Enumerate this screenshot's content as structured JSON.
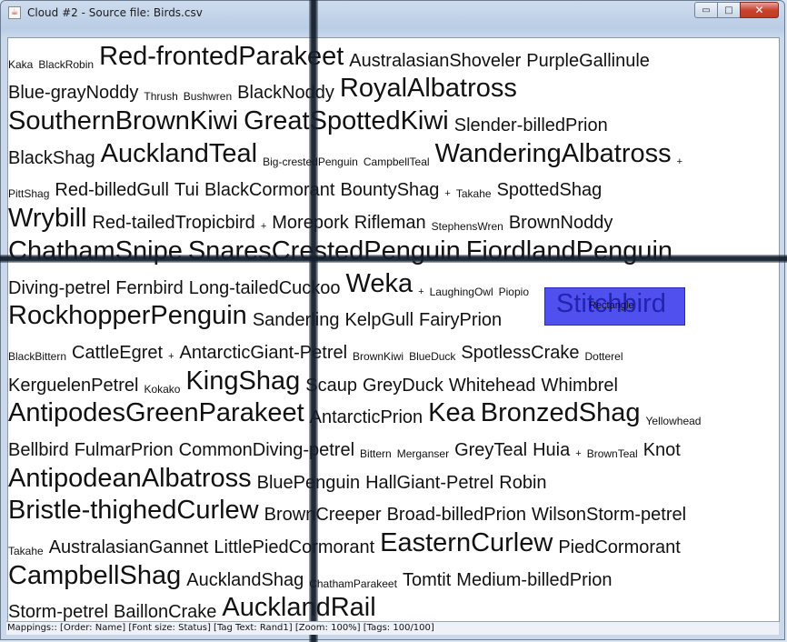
{
  "window": {
    "title": "Cloud #2 - Source file: Birds.csv",
    "controls": {
      "minimize": "▭",
      "maximize": "□",
      "close": "✕"
    },
    "app_icon": "java-cup-icon"
  },
  "cloud": {
    "rows": [
      [
        [
          "Kaka",
          1
        ],
        [
          "BlackRobin",
          1
        ],
        [
          "Red-frontedParakeet",
          3
        ],
        [
          "AustralasianShoveler",
          2
        ],
        [
          "PurpleGallinule",
          2
        ]
      ],
      [
        [
          "Blue-grayNoddy",
          2
        ],
        [
          "Thrush",
          1
        ],
        [
          "Bushwren",
          1
        ],
        [
          "BlackNoddy",
          2
        ],
        [
          "RoyalAlbatross",
          3
        ]
      ],
      [
        [
          "SouthernBrownKiwi",
          3
        ],
        [
          "GreatSpottedKiwi",
          3
        ],
        [
          "Slender-billedPrion",
          2
        ]
      ],
      [
        [
          "BlackShag",
          2
        ],
        [
          "AucklandTeal",
          3
        ],
        [
          "Big-crestedPenguin",
          1
        ],
        [
          "CampbellTeal",
          1
        ],
        [
          "WanderingAlbatross",
          3
        ],
        [
          "+",
          0
        ]
      ],
      [
        [
          "PittShag",
          1
        ],
        [
          "Red-billedGull",
          2
        ],
        [
          "Tui",
          2
        ],
        [
          "BlackCormorant",
          2
        ],
        [
          "BountyShag",
          2
        ],
        [
          "+",
          0
        ],
        [
          "Takahe",
          1
        ],
        [
          "SpottedShag",
          2
        ]
      ],
      [
        [
          "Wrybill",
          3
        ],
        [
          "Red-tailedTropicbird",
          2
        ],
        [
          "+",
          0
        ],
        [
          "Morepork",
          2
        ],
        [
          "Rifleman",
          2
        ],
        [
          "StephensWren",
          1
        ],
        [
          "BrownNoddy",
          2
        ]
      ],
      [
        [
          "ChathamSnipe",
          3
        ],
        [
          "SnaresCrestedPenguin",
          3
        ],
        [
          "FiordlandPenguin",
          3
        ]
      ],
      [
        [
          "Diving-petrel",
          2
        ],
        [
          "Fernbird",
          2
        ],
        [
          "Long-tailedCuckoo",
          2
        ],
        [
          "Weka",
          3
        ],
        [
          "+",
          0
        ],
        [
          "LaughingOwl",
          1
        ],
        [
          "Piopio",
          1
        ]
      ],
      [
        [
          "RockhopperPenguin",
          3
        ],
        [
          "Sanderling",
          2
        ],
        [
          "KelpGull",
          2
        ],
        [
          "FairyPrion",
          2
        ]
      ],
      [
        [
          "BlackBittern",
          1
        ],
        [
          "CattleEgret",
          2
        ],
        [
          "+",
          0
        ],
        [
          "AntarcticGiant-Petrel",
          2
        ],
        [
          "BrownKiwi",
          1
        ],
        [
          "BlueDuck",
          1
        ],
        [
          "SpotlessCrake",
          2
        ],
        [
          "Dotterel",
          1
        ]
      ],
      [
        [
          "KerguelenPetrel",
          2
        ],
        [
          "Kokako",
          1
        ],
        [
          "KingShag",
          3
        ],
        [
          "Scaup",
          2
        ],
        [
          "GreyDuck",
          2
        ],
        [
          "Whitehead",
          2
        ],
        [
          "Whimbrel",
          2
        ]
      ],
      [
        [
          "AntipodesGreenParakeet",
          3
        ],
        [
          "AntarcticPrion",
          2
        ],
        [
          "Kea",
          3
        ],
        [
          "BronzedShag",
          3
        ],
        [
          "Yellowhead",
          1
        ]
      ],
      [
        [
          "Bellbird",
          2
        ],
        [
          "FulmarPrion",
          2
        ],
        [
          "CommonDiving-petrel",
          2
        ],
        [
          "Bittern",
          1
        ],
        [
          "Merganser",
          1
        ],
        [
          "GreyTeal",
          2
        ],
        [
          "Huia",
          2
        ],
        [
          "+",
          0
        ],
        [
          "BrownTeal",
          1
        ],
        [
          "Knot",
          2
        ]
      ],
      [
        [
          "AntipodeanAlbatross",
          3
        ],
        [
          "BluePenguin",
          2
        ],
        [
          "HallGiant-Petrel",
          2
        ],
        [
          "Robin",
          2
        ]
      ],
      [
        [
          "Bristle-thighedCurlew",
          3
        ],
        [
          "BrownCreeper",
          2
        ],
        [
          "Broad-billedPrion",
          2
        ],
        [
          "WilsonStorm-petrel",
          2
        ]
      ],
      [
        [
          "Takahe",
          1
        ],
        [
          "AustralasianGannet",
          2
        ],
        [
          "LittlePiedCormorant",
          2
        ],
        [
          "EasternCurlew",
          3
        ],
        [
          "PiedCormorant",
          2
        ]
      ],
      [
        [
          "CampbellShag",
          3
        ],
        [
          "AucklandShag",
          2
        ],
        [
          "ChathamParakeet",
          1
        ],
        [
          "Tomtit",
          2
        ],
        [
          "Medium-billedPrion",
          2
        ]
      ],
      [
        [
          "Storm-petrel",
          2
        ],
        [
          "BaillonCrake",
          2
        ],
        [
          "AucklandRail",
          3
        ]
      ]
    ],
    "selected_tag": {
      "text": "Stitchbird",
      "label": "Rectangle",
      "fill": "#5050ef"
    }
  },
  "status_bar": "Mappings:: [Order: Name]  [Font size: Status]  [Tag Text: Rand1]  [Zoom: 100%]  [Tags: 100/100]"
}
